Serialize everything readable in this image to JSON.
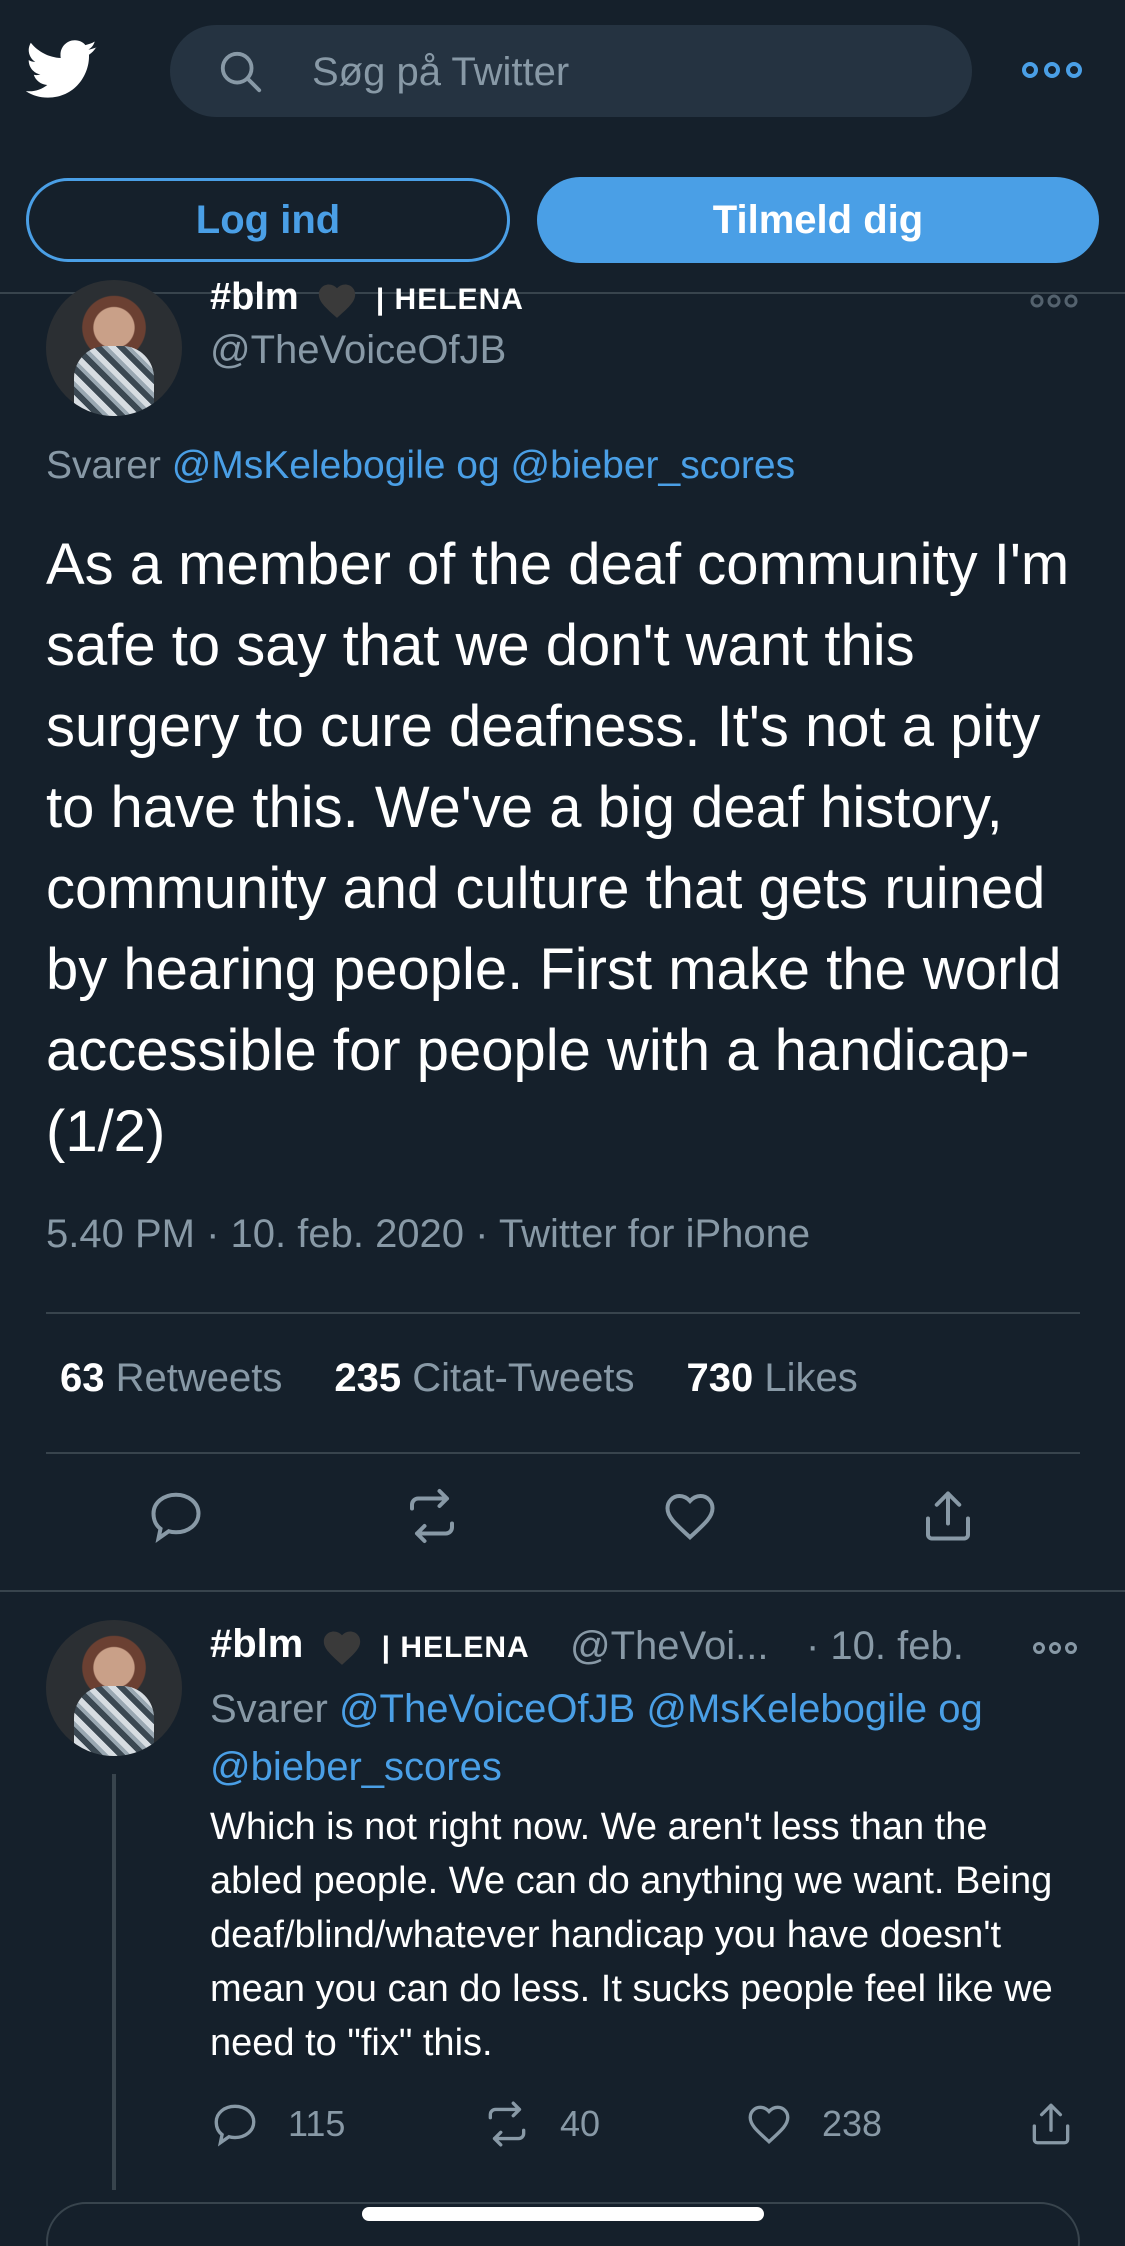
{
  "header": {
    "search_placeholder": "Søg på Twitter",
    "login_label": "Log ind",
    "signup_label": "Tilmeld dig"
  },
  "main_tweet": {
    "name": "#blm",
    "name_suffix": "| HELENA",
    "handle": "@TheVoiceOfJB",
    "reply_prefix": "Svarer",
    "reply_user1": "@MsKelebogile",
    "reply_and": "og",
    "reply_user2": "@bieber_scores",
    "text": "As a member of the deaf community I'm safe to say that we don't want this surgery to cure deafness. It's not a pity to have this. We've a big deaf history, community and culture that gets ruined by hearing people. First make the world accessible for people with a handicap- (1/2)",
    "meta": "5.40 PM · 10. feb. 2020 · Twitter for iPhone",
    "retweets_count": "63",
    "retweets_label": "Retweets",
    "quotes_count": "235",
    "quotes_label": "Citat-Tweets",
    "likes_count": "730",
    "likes_label": "Likes"
  },
  "reply_tweet": {
    "name": "#blm",
    "name_suffix": "| HELENA",
    "handle": "@TheVoi...",
    "date": "· 10. feb.",
    "reply_prefix": "Svarer",
    "reply_user1": "@TheVoiceOfJB",
    "reply_user2": "@MsKelebogile",
    "reply_and": "og",
    "reply_user3": "@bieber_scores",
    "text": "Which is not right now. We aren't less than the abled people. We can do anything we want. Being deaf/blind/whatever handicap you have doesn't mean you can do less. It sucks people feel like we need to \"fix\" this.",
    "replies": "115",
    "retweets": "40",
    "likes": "238"
  },
  "colors": {
    "background": "#15202b",
    "accent": "#4a9fe6",
    "muted": "#8899a6",
    "divider": "#38444d"
  }
}
